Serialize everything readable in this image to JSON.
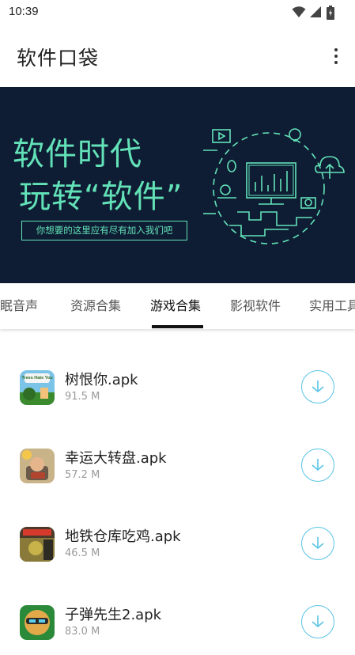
{
  "status_bar": {
    "time": "10:39"
  },
  "app_bar": {
    "title": "软件口袋"
  },
  "banner": {
    "headline_1": "软件时代",
    "headline_2": "玩转“软件”",
    "subtitle": "你想要的这里应有尽有加入我们吧"
  },
  "tabs": [
    {
      "label": "助眠音声"
    },
    {
      "label": "资源合集"
    },
    {
      "label": "游戏合集",
      "active": true
    },
    {
      "label": "影视软件"
    },
    {
      "label": "实用工具"
    }
  ],
  "apps": [
    {
      "name": "树恨你.apk",
      "size": "91.5 M",
      "icon_text": "Trees Hate You"
    },
    {
      "name": "幸运大转盘.apk",
      "size": "57.2 M"
    },
    {
      "name": "地铁仓库吃鸡.apk",
      "size": "46.5 M"
    },
    {
      "name": "子弹先生2.apk",
      "size": "83.0 M"
    }
  ],
  "colors": {
    "banner_bg": "#0e1d34",
    "banner_accent": "#63e2b8",
    "download_accent": "#59c4e6"
  },
  "icons": {
    "wifi": "wifi-icon",
    "signal": "signal-icon",
    "battery": "battery-icon",
    "more": "more-vert-icon",
    "download": "download-icon"
  }
}
